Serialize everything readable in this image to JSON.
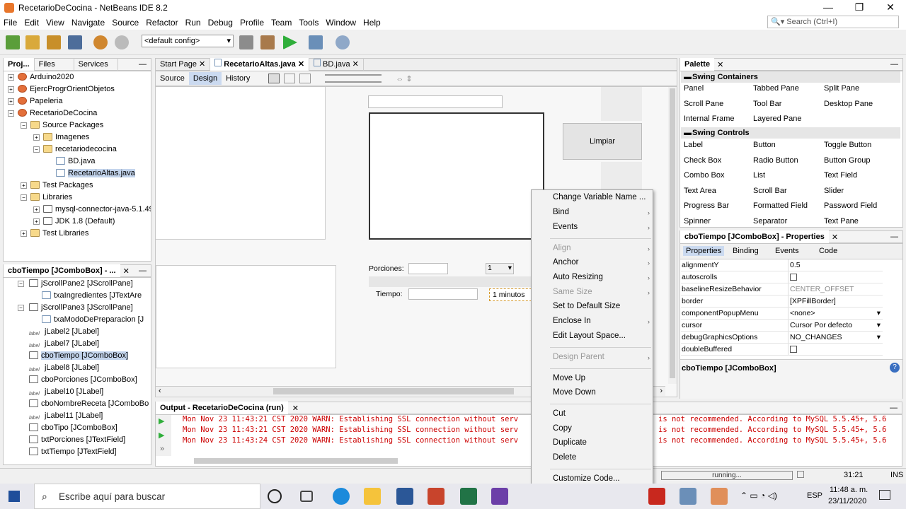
{
  "window": {
    "title": "RecetarioDeCocina - NetBeans IDE 8.2",
    "search_placeholder": "Search (Ctrl+I)"
  },
  "menu": [
    "File",
    "Edit",
    "View",
    "Navigate",
    "Source",
    "Refactor",
    "Run",
    "Debug",
    "Profile",
    "Team",
    "Tools",
    "Window",
    "Help"
  ],
  "toolbar": {
    "config": "<default config>"
  },
  "project_panel": {
    "tabs": [
      "Proj...",
      "Files",
      "Services"
    ],
    "items": [
      "Arduino2020",
      "EjercProgrOrientObjetos",
      "Papeleria",
      "RecetarioDeCocina",
      "Source Packages",
      "Imagenes",
      "recetariodecocina",
      "BD.java",
      "RecetarioAltas.java",
      "Test Packages",
      "Libraries",
      "mysql-connector-java-5.1.49-",
      "JDK 1.8 (Default)",
      "Test Libraries"
    ]
  },
  "navigator": {
    "title": "cboTiempo [JComboBox] - ...",
    "items": [
      "jScrollPane2 [JScrollPane]",
      "txaIngredientes [JTextAre",
      "jScrollPane3 [JScrollPane]",
      "txaModoDePreparacion [J",
      "jLabel2 [JLabel]",
      "jLabel7 [JLabel]",
      "cboTiempo [JComboBox]",
      "jLabel8 [JLabel]",
      "cboPorciones [JComboBox]",
      "jLabel10 [JLabel]",
      "cboNombreReceta [JComboBo",
      "jLabel11 [JLabel]",
      "cboTipo [JComboBox]",
      "txtPorciones [JTextField]",
      "txtTiempo [JTextField]"
    ]
  },
  "editor": {
    "tabs": [
      "Start Page",
      "RecetarioAltas.java",
      "BD.java"
    ],
    "views": [
      "Source",
      "Design",
      "History"
    ],
    "form": {
      "btn_limpiar": "Limpiar",
      "lbl_porciones": "Porciones:",
      "lbl_tiempo": "Tiempo:",
      "porciones_value": "1",
      "tiempo_value": "1 minutos"
    }
  },
  "context_menu": {
    "items": [
      {
        "label": "Change Variable Name ...",
        "sub": false,
        "disabled": false
      },
      {
        "label": "Bind",
        "sub": true,
        "disabled": false
      },
      {
        "label": "Events",
        "sub": true,
        "disabled": false
      },
      {
        "label": "Align",
        "sub": true,
        "disabled": true
      },
      {
        "label": "Anchor",
        "sub": true,
        "disabled": false
      },
      {
        "label": "Auto Resizing",
        "sub": true,
        "disabled": false
      },
      {
        "label": "Same Size",
        "sub": true,
        "disabled": true
      },
      {
        "label": "Set to Default Size",
        "sub": false,
        "disabled": false
      },
      {
        "label": "Enclose In",
        "sub": true,
        "disabled": false
      },
      {
        "label": "Edit Layout Space...",
        "sub": false,
        "disabled": false
      },
      {
        "label": "Design Parent",
        "sub": true,
        "disabled": true
      },
      {
        "label": "Move Up",
        "sub": false,
        "disabled": false
      },
      {
        "label": "Move Down",
        "sub": false,
        "disabled": false
      },
      {
        "label": "Cut",
        "sub": false,
        "disabled": false
      },
      {
        "label": "Copy",
        "sub": false,
        "disabled": false
      },
      {
        "label": "Duplicate",
        "sub": false,
        "disabled": false
      },
      {
        "label": "Delete",
        "sub": false,
        "disabled": false
      },
      {
        "label": "Customize Code...",
        "sub": false,
        "disabled": false
      },
      {
        "label": "Properties",
        "sub": false,
        "disabled": false
      }
    ]
  },
  "palette": {
    "title": "Palette",
    "sections": [
      "Swing Containers",
      "Swing Controls"
    ],
    "containers": [
      "Panel",
      "Tabbed Pane",
      "Split Pane",
      "Scroll Pane",
      "Tool Bar",
      "Desktop Pane",
      "Internal Frame",
      "Layered Pane"
    ],
    "controls": [
      "Label",
      "Button",
      "Toggle Button",
      "Check Box",
      "Radio Button",
      "Button Group",
      "Combo Box",
      "List",
      "Text Field",
      "Text Area",
      "Scroll Bar",
      "Slider",
      "Progress Bar",
      "Formatted Field",
      "Password Field",
      "Spinner",
      "Separator",
      "Text Pane"
    ]
  },
  "properties": {
    "title": "cboTiempo [JComboBox] - Properties",
    "tabs": [
      "Properties",
      "Binding",
      "Events",
      "Code"
    ],
    "rows": [
      [
        "alignmentY",
        "0.5"
      ],
      [
        "autoscrolls",
        ""
      ],
      [
        "baselineResizeBehavior",
        "CENTER_OFFSET"
      ],
      [
        "border",
        "[XPFillBorder]"
      ],
      [
        "componentPopupMenu",
        "<none>"
      ],
      [
        "cursor",
        "Cursor Por defecto"
      ],
      [
        "debugGraphicsOptions",
        "NO_CHANGES"
      ],
      [
        "doubleBuffered",
        ""
      ]
    ],
    "footer": "cboTiempo [JComboBox]"
  },
  "output": {
    "title": "Output - RecetarioDeCocina (run)",
    "left": [
      "Mon Nov 23 11:43:21 CST 2020 WARN: Establishing SSL connection without serv",
      "Mon Nov 23 11:43:21 CST 2020 WARN: Establishing SSL connection without serv",
      "Mon Nov 23 11:43:24 CST 2020 WARN: Establishing SSL connection without serv"
    ],
    "right": [
      "is not recommended. According to MySQL 5.5.45+, 5.6",
      "is not recommended. According to MySQL 5.5.45+, 5.6",
      "is not recommended. According to MySQL 5.5.45+, 5.6"
    ]
  },
  "status": {
    "running": "running...",
    "position": "31:21",
    "mode": "INS"
  },
  "taskbar": {
    "search": "Escribe aquí para buscar",
    "lang": "ESP",
    "time": "11:48 a. m.",
    "date": "23/11/2020"
  }
}
